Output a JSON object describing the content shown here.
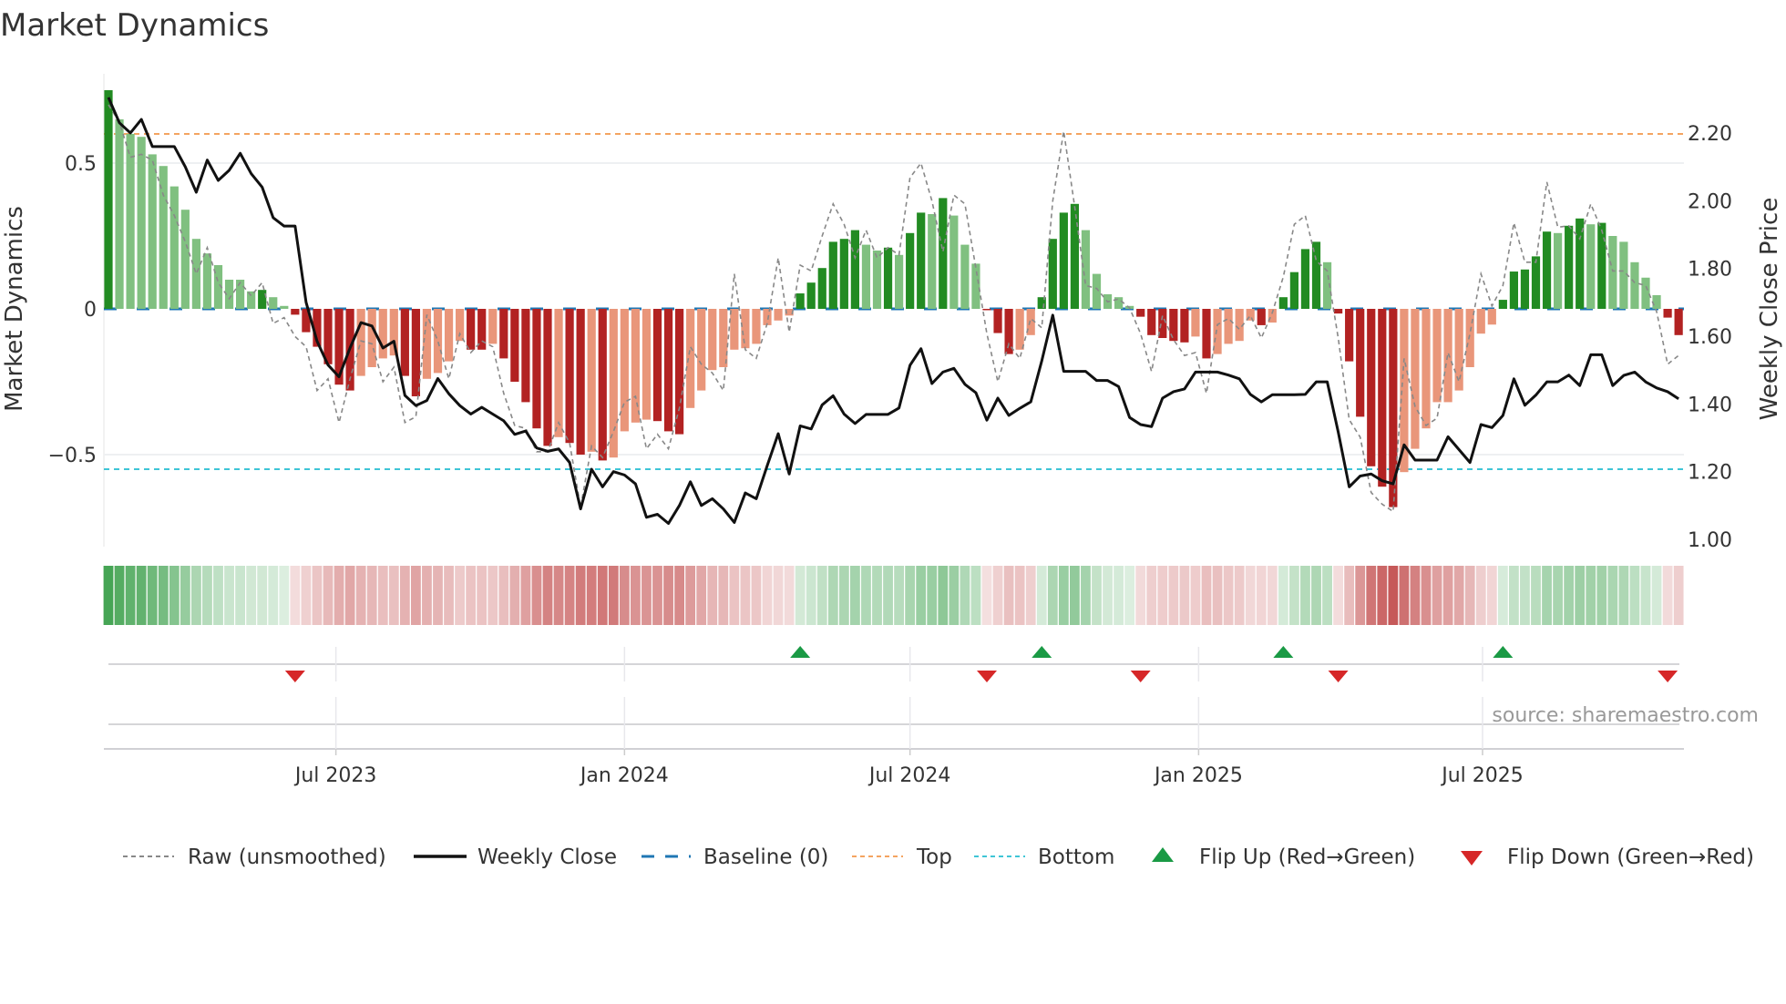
{
  "chart_data": {
    "type": "bar",
    "title": "Market Dynamics",
    "ylabel": "Market Dynamics",
    "ylabel_right": "Weekly Close Price",
    "ylim": [
      -0.8,
      0.8
    ],
    "ylim_right": [
      1.0,
      2.32
    ],
    "start_date": "2023-02-06",
    "frequency": "weekly",
    "left_ticks": [
      {
        "v": 0.5,
        "label": "0.5"
      },
      {
        "v": 0,
        "label": "0"
      },
      {
        "v": -0.5,
        "label": "−0.5"
      }
    ],
    "right_ticks": [
      {
        "v": 2.2,
        "label": "2.20"
      },
      {
        "v": 2.0,
        "label": "2.00"
      },
      {
        "v": 1.8,
        "label": "1.80"
      },
      {
        "v": 1.6,
        "label": "1.60"
      },
      {
        "v": 1.4,
        "label": "1.40"
      },
      {
        "v": 1.2,
        "label": "1.20"
      },
      {
        "v": 1.0,
        "label": "1.00"
      }
    ],
    "x_ticks": [
      {
        "date": "2023-07-01",
        "label": "Jul 2023"
      },
      {
        "date": "2024-01-01",
        "label": "Jan 2024"
      },
      {
        "date": "2024-07-01",
        "label": "Jul 2024"
      },
      {
        "date": "2025-01-01",
        "label": "Jan 2025"
      },
      {
        "date": "2025-07-01",
        "label": "Jul 2025"
      }
    ],
    "top_level": 0.6,
    "bottom_level": -0.55,
    "baseline": 0,
    "values": [
      0.75,
      0.65,
      0.6,
      0.59,
      0.53,
      0.49,
      0.42,
      0.34,
      0.24,
      0.19,
      0.15,
      0.1,
      0.1,
      0.06,
      0.065,
      0.04,
      0.01,
      -0.02,
      -0.08,
      -0.13,
      -0.19,
      -0.26,
      -0.28,
      -0.23,
      -0.2,
      -0.17,
      -0.16,
      -0.23,
      -0.3,
      -0.24,
      -0.22,
      -0.18,
      -0.11,
      -0.14,
      -0.14,
      -0.12,
      -0.17,
      -0.25,
      -0.32,
      -0.41,
      -0.47,
      -0.44,
      -0.46,
      -0.5,
      -0.49,
      -0.52,
      -0.51,
      -0.42,
      -0.39,
      -0.38,
      -0.385,
      -0.42,
      -0.43,
      -0.34,
      -0.28,
      -0.21,
      -0.2,
      -0.14,
      -0.135,
      -0.12,
      -0.056,
      -0.04,
      -0.023,
      0.053,
      0.09,
      0.14,
      0.23,
      0.24,
      0.27,
      0.22,
      0.2,
      0.21,
      0.185,
      0.26,
      0.33,
      0.325,
      0.38,
      0.32,
      0.22,
      0.155,
      -0.004,
      -0.083,
      -0.155,
      -0.14,
      -0.09,
      0.04,
      0.24,
      0.33,
      0.36,
      0.27,
      0.12,
      0.05,
      0.04,
      0.01,
      -0.027,
      -0.09,
      -0.1,
      -0.11,
      -0.115,
      -0.095,
      -0.17,
      -0.155,
      -0.12,
      -0.11,
      -0.04,
      -0.056,
      -0.047,
      0.04,
      0.126,
      0.205,
      0.23,
      0.16,
      -0.016,
      -0.18,
      -0.37,
      -0.54,
      -0.61,
      -0.68,
      -0.56,
      -0.48,
      -0.41,
      -0.32,
      -0.32,
      -0.28,
      -0.2,
      -0.085,
      -0.054,
      0.031,
      0.128,
      0.135,
      0.18,
      0.265,
      0.26,
      0.285,
      0.31,
      0.29,
      0.295,
      0.25,
      0.23,
      0.16,
      0.107,
      0.047,
      -0.03,
      -0.09
    ],
    "strong": [
      1,
      0,
      0,
      0,
      0,
      0,
      0,
      0,
      0,
      0,
      0,
      0,
      0,
      0,
      1,
      0,
      0,
      1,
      1,
      1,
      1,
      1,
      1,
      0,
      0,
      0,
      0,
      1,
      1,
      0,
      0,
      0,
      0,
      1,
      1,
      0,
      1,
      1,
      1,
      1,
      1,
      0,
      1,
      1,
      0,
      1,
      0,
      0,
      0,
      0,
      1,
      1,
      1,
      0,
      0,
      0,
      0,
      0,
      0,
      0,
      0,
      0,
      0,
      1,
      1,
      1,
      1,
      1,
      1,
      0,
      0,
      1,
      0,
      1,
      1,
      0,
      1,
      0,
      0,
      0,
      1,
      1,
      1,
      0,
      0,
      1,
      1,
      1,
      1,
      0,
      0,
      0,
      0,
      0,
      1,
      1,
      1,
      1,
      1,
      0,
      1,
      0,
      0,
      0,
      0,
      1,
      0,
      1,
      1,
      1,
      1,
      0,
      1,
      1,
      1,
      1,
      1,
      1,
      0,
      0,
      0,
      0,
      0,
      0,
      0,
      0,
      0,
      1,
      1,
      1,
      1,
      1,
      0,
      1,
      1,
      0,
      1,
      0,
      0,
      0,
      0,
      0,
      1,
      1
    ],
    "raw": [
      0.7,
      0.64,
      0.52,
      0.53,
      0.51,
      0.39,
      0.32,
      0.23,
      0.12,
      0.21,
      0.09,
      0.035,
      0.09,
      0.045,
      0.09,
      -0.05,
      -0.03,
      -0.095,
      -0.13,
      -0.28,
      -0.24,
      -0.39,
      -0.24,
      -0.11,
      -0.12,
      -0.25,
      -0.2,
      -0.39,
      -0.37,
      -0.02,
      -0.11,
      -0.24,
      -0.085,
      -0.15,
      -0.11,
      -0.13,
      -0.29,
      -0.4,
      -0.41,
      -0.49,
      -0.49,
      -0.39,
      -0.46,
      -0.68,
      -0.47,
      -0.51,
      -0.42,
      -0.32,
      -0.3,
      -0.48,
      -0.43,
      -0.48,
      -0.34,
      -0.13,
      -0.19,
      -0.22,
      -0.28,
      0.12,
      -0.14,
      -0.17,
      -0.05,
      0.175,
      -0.08,
      0.15,
      0.13,
      0.25,
      0.36,
      0.29,
      0.175,
      0.27,
      0.175,
      0.21,
      0.185,
      0.45,
      0.5,
      0.37,
      0.196,
      0.39,
      0.36,
      0.14,
      -0.085,
      -0.25,
      -0.12,
      -0.17,
      -0.033,
      -0.065,
      0.37,
      0.61,
      0.35,
      0.08,
      0.07,
      0.024,
      0.034,
      0.003,
      -0.085,
      -0.215,
      -0.023,
      -0.106,
      -0.16,
      -0.15,
      -0.29,
      -0.054,
      -0.033,
      -0.07,
      -0.023,
      -0.1,
      -0.013,
      0.11,
      0.29,
      0.32,
      0.165,
      0.13,
      -0.1,
      -0.38,
      -0.44,
      -0.63,
      -0.67,
      -0.695,
      -0.17,
      -0.335,
      -0.4,
      -0.375,
      -0.15,
      -0.25,
      -0.085,
      0.12,
      0.01,
      0.08,
      0.295,
      0.16,
      0.16,
      0.435,
      0.28,
      0.285,
      0.24,
      0.36,
      0.27,
      0.13,
      0.13,
      0.09,
      0.08,
      -0.01,
      -0.19,
      -0.16
    ],
    "close": [
      2.305,
      2.23,
      2.2,
      2.24,
      2.16,
      2.16,
      2.16,
      2.1,
      2.025,
      2.12,
      2.06,
      2.09,
      2.14,
      2.08,
      2.04,
      1.95,
      1.925,
      1.925,
      1.7,
      1.585,
      1.515,
      1.48,
      1.565,
      1.64,
      1.63,
      1.565,
      1.585,
      1.425,
      1.395,
      1.41,
      1.475,
      1.43,
      1.395,
      1.37,
      1.39,
      1.37,
      1.35,
      1.31,
      1.32,
      1.27,
      1.26,
      1.267,
      1.227,
      1.09,
      1.207,
      1.155,
      1.2,
      1.19,
      1.164,
      1.065,
      1.074,
      1.047,
      1.1,
      1.17,
      1.1,
      1.12,
      1.09,
      1.05,
      1.137,
      1.12,
      1.218,
      1.312,
      1.193,
      1.335,
      1.326,
      1.397,
      1.424,
      1.37,
      1.342,
      1.369,
      1.369,
      1.369,
      1.388,
      1.514,
      1.563,
      1.46,
      1.494,
      1.505,
      1.458,
      1.433,
      1.352,
      1.417,
      1.366,
      1.387,
      1.406,
      1.527,
      1.662,
      1.496,
      1.496,
      1.496,
      1.469,
      1.469,
      1.451,
      1.36,
      1.339,
      1.333,
      1.417,
      1.436,
      1.444,
      1.494,
      1.494,
      1.494,
      1.485,
      1.474,
      1.428,
      1.406,
      1.427,
      1.427,
      1.427,
      1.428,
      1.465,
      1.465,
      1.317,
      1.155,
      1.187,
      1.193,
      1.173,
      1.164,
      1.279,
      1.234,
      1.234,
      1.234,
      1.303,
      1.265,
      1.227,
      1.339,
      1.33,
      1.366,
      1.474,
      1.396,
      1.426,
      1.465,
      1.465,
      1.485,
      1.454,
      1.545,
      1.545,
      1.454,
      1.484,
      1.494,
      1.465,
      1.447,
      1.436,
      1.415
    ],
    "flip_up_bars": [
      64,
      86,
      108,
      128
    ],
    "flip_down_bars": [
      18,
      81,
      95,
      113,
      143
    ],
    "legend": {
      "placement": "bottom",
      "raw": "Raw (unsmoothed)",
      "close": "Weekly Close",
      "baseline": "Baseline (0)",
      "top": "Top",
      "bottom": "Bottom",
      "flip_up": "Flip Up (Red→Green)",
      "flip_down": "Flip Down (Green→Red)"
    },
    "source": "source: sharemaestro.com",
    "colors": {
      "strong_green": "#228b22",
      "light_green": "#80c080",
      "strong_red": "#b22222",
      "light_red": "#e9967a",
      "close": "#111111",
      "raw": "#888888",
      "baseline": "#1f77b4",
      "top": "#f4a460",
      "bottom": "#3fc5d6",
      "flip_up": "#1a9a45",
      "flip_down": "#d62728"
    }
  }
}
